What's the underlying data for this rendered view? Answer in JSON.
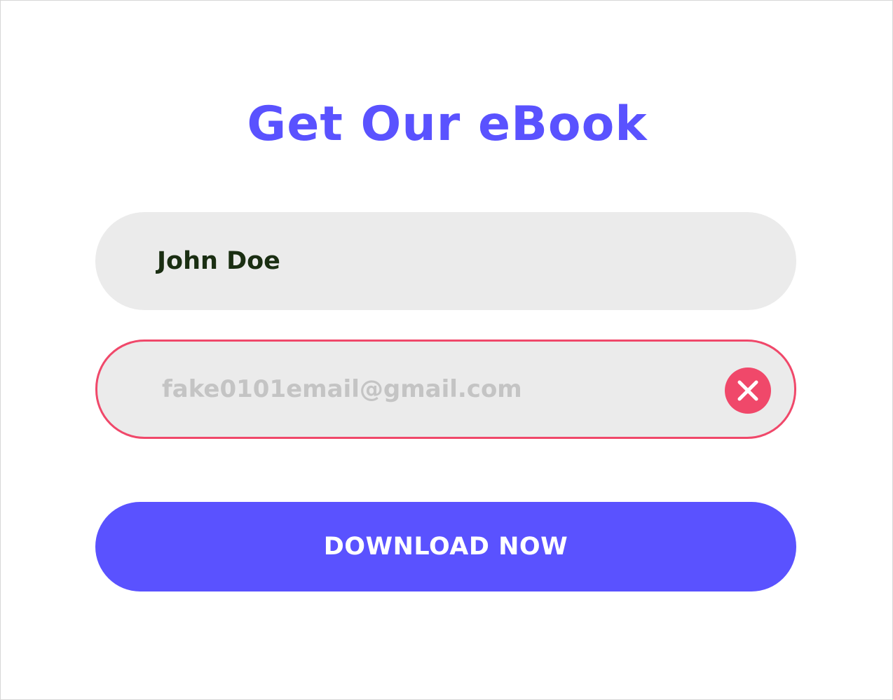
{
  "form": {
    "title": "Get Our eBook",
    "name_value": "John Doe",
    "email_placeholder": "fake0101email@gmail.com",
    "email_state": "error",
    "clear_icon": "close-icon",
    "button_label": "DOWNLOAD NOW"
  },
  "colors": {
    "accent": "#5a52ff",
    "field_background": "#ebebeb",
    "error": "#f0486a",
    "name_text": "#1a2e12",
    "placeholder_text": "#c4c4c4",
    "button_text": "#ffffff"
  }
}
